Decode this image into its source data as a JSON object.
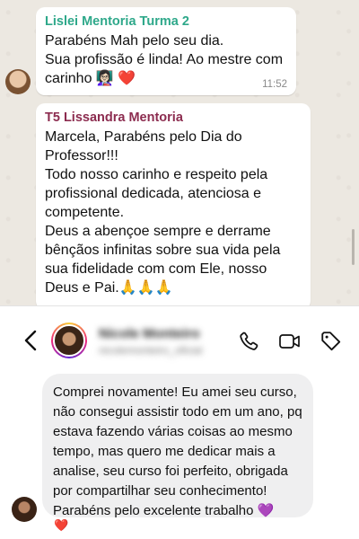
{
  "whatsapp": {
    "messages": [
      {
        "sender": "Lislei Mentoria Turma 2",
        "text": "Parabéns Mah pelo seu dia.\nSua profissão é linda! Ao mestre com carinho 👩🏻‍🏫 ❤️",
        "time": "11:52"
      },
      {
        "sender": "T5 Lissandra Mentoria",
        "text": "Marcela, Parabéns  pelo Dia do Professor!!!\nTodo nosso carinho e respeito pela profissional dedicada, atenciosa e competente.\nDeus a abençoe  sempre e derrame bênçãos  infinitas sobre sua vida pela sua fidelidade com com Ele, nosso Deus e Pai.🙏🙏🙏"
      }
    ]
  },
  "instagram": {
    "contact_name": "Nicole Monteiro",
    "contact_handle": "nicolemonteiro_oficial",
    "message": "Comprei novamente! Eu amei seu curso, não consegui assistir todo em um ano, pq estava fazendo várias coisas ao mesmo tempo, mas quero me dedicar mais a analise, seu curso foi perfeito, obrigada por compartilhar seu conhecimento! Parabéns pelo excelente trabalho 💜",
    "reaction": "❤️",
    "icons": [
      "back-icon",
      "phone-icon",
      "video-icon",
      "tag-icon"
    ]
  },
  "colors": {
    "wa_sender_1": "#2ea88a",
    "wa_sender_2": "#8c2c4f",
    "wa_background": "#ece8e1",
    "dm_bubble": "#efeff0"
  }
}
